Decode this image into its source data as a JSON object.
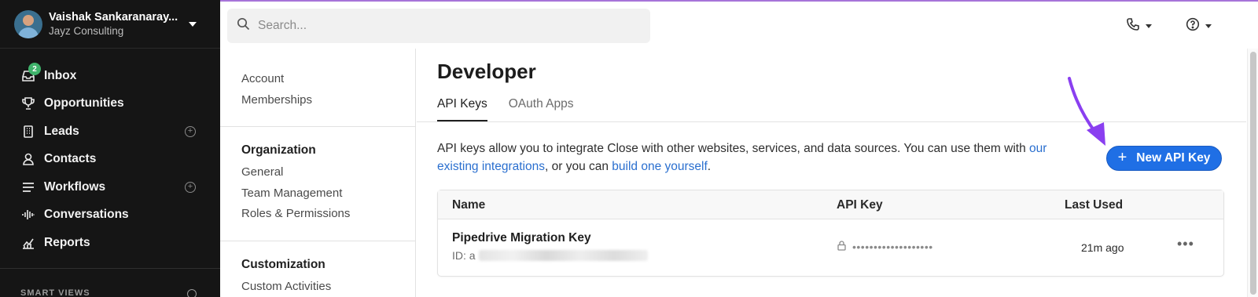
{
  "profile": {
    "name": "Vaishak Sankaranaray...",
    "org": "Jayz Consulting"
  },
  "nav": {
    "items": [
      {
        "label": "Inbox",
        "icon": "inbox-icon",
        "badge": "2"
      },
      {
        "label": "Opportunities",
        "icon": "trophy-icon"
      },
      {
        "label": "Leads",
        "icon": "building-icon"
      },
      {
        "label": "Contacts",
        "icon": "person-icon"
      },
      {
        "label": "Workflows",
        "icon": "list-icon"
      },
      {
        "label": "Conversations",
        "icon": "waveform-icon"
      },
      {
        "label": "Reports",
        "icon": "chart-icon"
      }
    ],
    "smart_views": "SMART VIEWS"
  },
  "search": {
    "placeholder": "Search..."
  },
  "subnav": {
    "top": [
      "Account",
      "Memberships"
    ],
    "organization": {
      "heading": "Organization",
      "items": [
        "General",
        "Team Management",
        "Roles & Permissions"
      ]
    },
    "customization": {
      "heading": "Customization",
      "items": [
        "Custom Activities"
      ]
    }
  },
  "main": {
    "title": "Developer",
    "tabs": [
      "API Keys",
      "OAuth Apps"
    ],
    "desc_pre": "API keys allow you to integrate Close with other websites, services, and data sources. You can use them with ",
    "desc_link1": "our existing integrations",
    "desc_mid": ", or you can ",
    "desc_link2": "build one yourself",
    "desc_post": ".",
    "new_button": "New API Key",
    "table": {
      "headers": {
        "name": "Name",
        "key": "API Key",
        "last_used": "Last Used"
      },
      "rows": [
        {
          "name": "Pipedrive Migration Key",
          "id_prefix": "ID: a",
          "masked": "•••••••••••••••••••",
          "last_used": "21m ago"
        }
      ]
    }
  },
  "colors": {
    "accent": "#1f6fe5",
    "arrow": "#8a3ff0",
    "sidebar": "#151515",
    "link": "#2a6fcf"
  }
}
